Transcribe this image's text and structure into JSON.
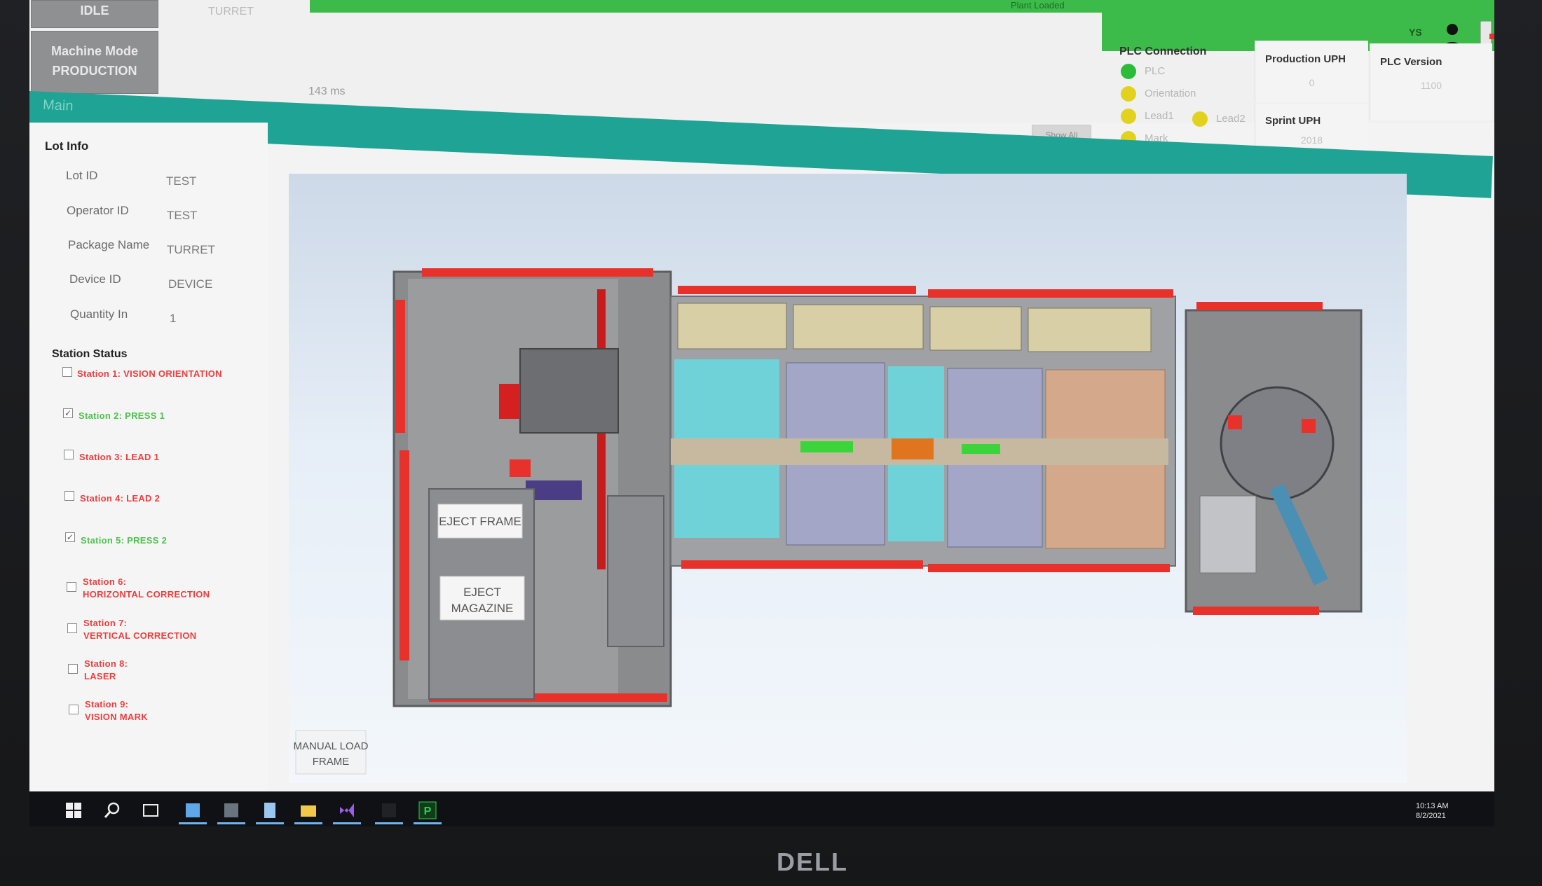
{
  "header": {
    "state_label": "IDLE",
    "machine_mode_label": "Machine Mode",
    "machine_mode_value": "PRODUCTION",
    "package_name_mini": "TURRET",
    "green_strip_text": "Plant Loaded",
    "cycle_time": "143 ms",
    "user_code": "YS",
    "show_all_label": "Show All"
  },
  "plc": {
    "title": "PLC Connection",
    "items": [
      {
        "label": "PLC",
        "color": "#2bbd3a"
      },
      {
        "label": "Orientation",
        "color": "#e3d21d"
      },
      {
        "label": "Lead1",
        "color": "#e3d21d"
      },
      {
        "label": "Lead2",
        "color": "#e3d21d"
      },
      {
        "label": "Mark",
        "color": "#e3d21d"
      }
    ]
  },
  "stats": {
    "production_uph_label": "Production UPH",
    "production_uph_value": "0",
    "sprint_uph_label": "Sprint UPH",
    "sprint_uph_value": "2018",
    "plc_version_label": "PLC Version",
    "plc_version_value": "1100"
  },
  "tabs": {
    "main": "Main"
  },
  "lot_info": {
    "title": "Lot Info",
    "fields": [
      {
        "label": "Lot ID",
        "value": "TEST"
      },
      {
        "label": "Operator ID",
        "value": "TEST"
      },
      {
        "label": "Package Name",
        "value": "TURRET"
      },
      {
        "label": "Device ID",
        "value": "DEVICE"
      },
      {
        "label": "Quantity In",
        "value": "1"
      }
    ]
  },
  "station_status": {
    "title": "Station Status",
    "stations": [
      {
        "line1": "Station 1: VISION ORIENTATION",
        "line2": "",
        "checked": false,
        "status": "red"
      },
      {
        "line1": "Station 2: PRESS 1",
        "line2": "",
        "checked": true,
        "status": "green"
      },
      {
        "line1": "Station 3: LEAD 1",
        "line2": "",
        "checked": false,
        "status": "red"
      },
      {
        "line1": "Station 4: LEAD 2",
        "line2": "",
        "checked": false,
        "status": "red"
      },
      {
        "line1": "Station 5: PRESS 2",
        "line2": "",
        "checked": true,
        "status": "green"
      },
      {
        "line1": "Station 6:",
        "line2": "HORIZONTAL CORRECTION",
        "checked": false,
        "status": "red"
      },
      {
        "line1": "Station 7:",
        "line2": "VERTICAL CORRECTION",
        "checked": false,
        "status": "red"
      },
      {
        "line1": "Station 8:",
        "line2": "LASER",
        "checked": false,
        "status": "red"
      },
      {
        "line1": "Station 9:",
        "line2": "VISION MARK",
        "checked": false,
        "status": "red"
      }
    ]
  },
  "machine": {
    "eject_frame_label": "EJECT FRAME",
    "eject_magazine_label_1": "EJECT",
    "eject_magazine_label_2": "MAGAZINE",
    "manual_load_label_1": "MANUAL LOAD",
    "manual_load_label_2": "FRAME",
    "alarm_color": "#e8312a"
  },
  "brand": "DELL",
  "tray": {
    "time": "10:13 AM",
    "date": "8/2/2021"
  }
}
